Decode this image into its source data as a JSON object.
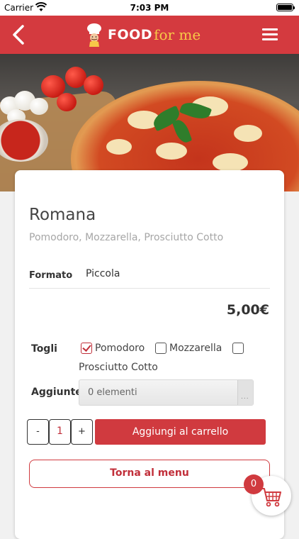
{
  "status_bar": {
    "carrier": "Carrier",
    "time": "7:03 PM"
  },
  "header": {
    "brand_food": "FOOD",
    "brand_forme": "for me"
  },
  "product": {
    "name": "Romana",
    "ingredients": "Pomodoro, Mozzarella, Prosciutto Cotto",
    "format_label": "Formato",
    "format_value": "Piccola",
    "price": "5,00€"
  },
  "remove": {
    "label": "Togli",
    "options": [
      {
        "label": "Pomodoro",
        "checked": true
      },
      {
        "label": "Mozzarella",
        "checked": false
      },
      {
        "label": "Prosciutto Cotto",
        "checked": false
      }
    ]
  },
  "additions": {
    "label": "Aggiunte",
    "value": "0 elementi",
    "handle": "..."
  },
  "quantity": {
    "minus": "-",
    "value": "1",
    "plus": "+"
  },
  "buttons": {
    "add_to_cart": "Aggiungi al carrello",
    "back_to_menu": "Torna al menu"
  },
  "cart": {
    "count": "0"
  },
  "colors": {
    "brand_red": "#d43a3f",
    "accent_yellow": "#f7c948"
  }
}
